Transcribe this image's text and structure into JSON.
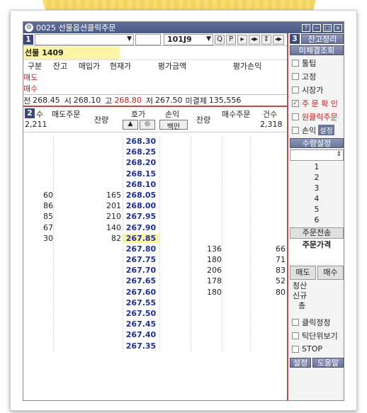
{
  "window": {
    "title": "0025 선물옵션클릭주문",
    "title_buttons": [
      "?",
      "−",
      "□",
      "×"
    ]
  },
  "toolbar": {
    "panel_no": "1",
    "combo1_value": "",
    "code_value": "101J9",
    "buttons": [
      "Q",
      "P",
      "▸",
      "◂▸",
      "⇕",
      "◂▸"
    ]
  },
  "instrument": {
    "name": "선물 1409"
  },
  "positions": {
    "headers": [
      "구분",
      "잔고",
      "매입가",
      "현재가",
      "평가금액",
      "평가손익"
    ],
    "rows": [
      [
        "매도",
        "",
        "",
        "",
        "",
        ""
      ],
      [
        "매수",
        "",
        "",
        "",
        "",
        ""
      ]
    ]
  },
  "ohlc": {
    "prev_label": "전",
    "prev": "268.45",
    "open_label": "시",
    "open": "268.10",
    "high_label": "고",
    "high": "268.80",
    "low_label": "저",
    "low": "267.50",
    "oi_label": "미결제",
    "oi": "135,556"
  },
  "hoga": {
    "panel_no": "2",
    "h_count": "수",
    "h_sell_order": "매도주문",
    "h_sell_qty": "잔량",
    "h_price": "호가",
    "h_pnl": "손익",
    "pnl_unit": "백만",
    "h_buy_qty": "잔량",
    "h_buy_order": "매수주문",
    "h_buy_count": "건수",
    "sell_total_count": "2,211",
    "buy_total_count": "2,318",
    "up_arrow": "▲",
    "center_icon": "◎",
    "rows": [
      {
        "price": "268.30",
        "sc": "",
        "sq": "",
        "bq": "",
        "bc": ""
      },
      {
        "price": "268.25",
        "sc": "",
        "sq": "",
        "bq": "",
        "bc": ""
      },
      {
        "price": "268.20",
        "sc": "",
        "sq": "",
        "bq": "",
        "bc": ""
      },
      {
        "price": "268.15",
        "sc": "",
        "sq": "",
        "bq": "",
        "bc": ""
      },
      {
        "price": "268.10",
        "sc": "",
        "sq": "",
        "bq": "",
        "bc": ""
      },
      {
        "price": "268.05",
        "sc": "60",
        "sq": "165",
        "bq": "",
        "bc": ""
      },
      {
        "price": "268.00",
        "sc": "86",
        "sq": "201",
        "bq": "",
        "bc": ""
      },
      {
        "price": "267.95",
        "sc": "85",
        "sq": "210",
        "bq": "",
        "bc": ""
      },
      {
        "price": "267.90",
        "sc": "67",
        "sq": "140",
        "bq": "",
        "bc": ""
      },
      {
        "price": "267.85",
        "sc": "30",
        "sq": "82",
        "bq": "",
        "bc": "",
        "current": true
      },
      {
        "price": "267.80",
        "sc": "",
        "sq": "",
        "bq": "136",
        "bc": "66"
      },
      {
        "price": "267.75",
        "sc": "",
        "sq": "",
        "bq": "180",
        "bc": "71"
      },
      {
        "price": "267.70",
        "sc": "",
        "sq": "",
        "bq": "206",
        "bc": "83"
      },
      {
        "price": "267.65",
        "sc": "",
        "sq": "",
        "bq": "178",
        "bc": "52"
      },
      {
        "price": "267.60",
        "sc": "",
        "sq": "",
        "bq": "180",
        "bc": "80"
      },
      {
        "price": "267.55",
        "sc": "",
        "sq": "",
        "bq": "",
        "bc": ""
      },
      {
        "price": "267.50",
        "sc": "",
        "sq": "",
        "bq": "",
        "bc": ""
      },
      {
        "price": "267.45",
        "sc": "",
        "sq": "",
        "bq": "",
        "bc": ""
      },
      {
        "price": "267.40",
        "sc": "",
        "sq": "",
        "bq": "",
        "bc": ""
      },
      {
        "price": "267.35",
        "sc": "",
        "sq": "",
        "bq": "",
        "bc": ""
      }
    ]
  },
  "side": {
    "panel_no": "3",
    "balance_btn": "잔고정리",
    "unfilled_btn": "미체결조회",
    "checks": [
      {
        "label": "툴팁",
        "checked": false,
        "red": false
      },
      {
        "label": "고정",
        "checked": false,
        "red": false
      },
      {
        "label": "시장가",
        "checked": false,
        "red": false
      },
      {
        "label": "주 문 확 인",
        "checked": true,
        "red": true
      },
      {
        "label": "원클릭주문",
        "checked": false,
        "red": true
      },
      {
        "label": "손익",
        "checked": false,
        "red": false
      }
    ],
    "pnl_setting_btn": "설정",
    "qty_setting_btn": "수량설정",
    "qty_values": [
      "1",
      "2",
      "3",
      "4",
      "5",
      "6"
    ],
    "send_order_btn": "주문전송",
    "order_price_label": "주문가격",
    "sell_btn": "매도",
    "buy_btn": "매수",
    "clear_label": "청산",
    "new_label": "신규",
    "total_label": "총",
    "bottom_checks": [
      "클릭정정",
      "틱단위보기",
      "STOP"
    ],
    "setting_btn": "설정",
    "help_btn": "도움말"
  },
  "colors": {
    "accent": "#3b4a78",
    "sell": "#c02020",
    "price": "#1d3192",
    "highlight": "#fbf3a6"
  }
}
